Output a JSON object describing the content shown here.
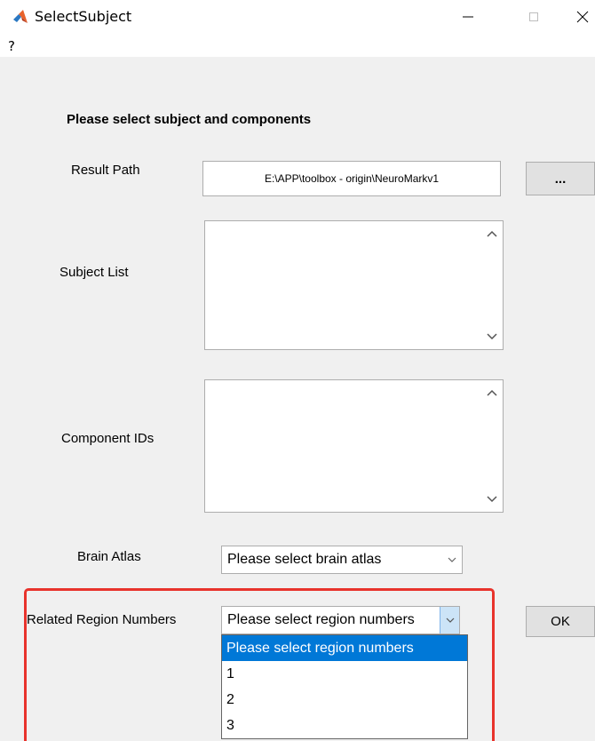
{
  "window": {
    "title": "SelectSubject",
    "minimize_icon": "minimize-icon",
    "maximize_icon": "maximize-icon",
    "close_icon": "close-icon"
  },
  "menu": {
    "help_label": "?"
  },
  "form": {
    "heading": "Please select subject and components",
    "result_path": {
      "label": "Result Path",
      "value": "E:\\APP\\toolbox - origin\\NeuroMarkv1",
      "browse_label": "..."
    },
    "subject_list": {
      "label": "Subject List",
      "items": []
    },
    "component_ids": {
      "label": "Component IDs",
      "items": []
    },
    "brain_atlas": {
      "label": "Brain Atlas",
      "selected": "Please select brain atlas"
    },
    "related_region_numbers": {
      "label": "Related Region Numbers",
      "selected": "Please select region numbers",
      "options": [
        "Please select region numbers",
        "1",
        "2",
        "3"
      ]
    },
    "ok_label": "OK"
  },
  "colors": {
    "highlight_box": "#e8332c",
    "selection": "#0078d7",
    "window_bg": "#f0f0f0"
  }
}
